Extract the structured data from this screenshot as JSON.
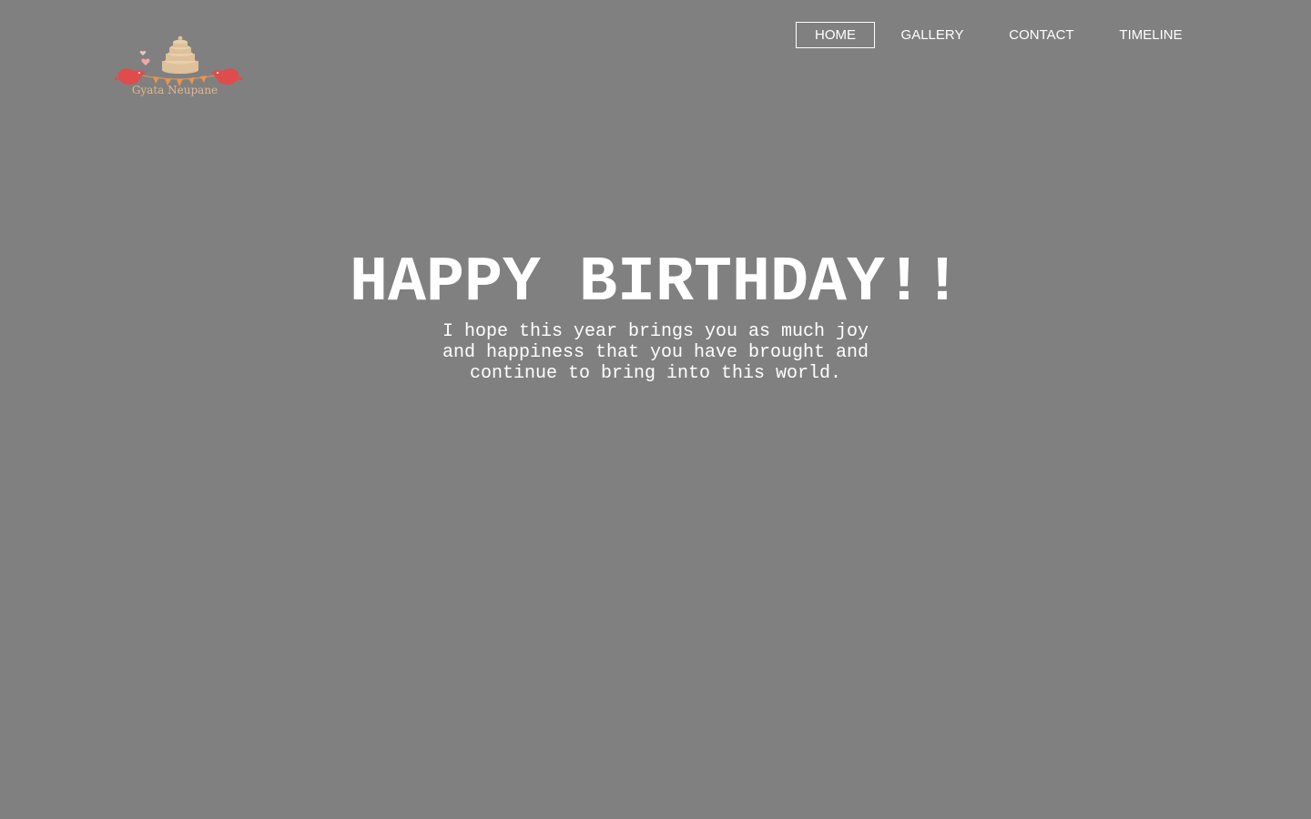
{
  "logo": {
    "text": "Gyata Neupane",
    "icon": "birthday-cake-with-birds-and-bunting-icon",
    "colors": {
      "cake": "#dec09a",
      "birds": "#e04b4b",
      "bunting": "#e9954f",
      "text": "#e3b889"
    }
  },
  "nav": {
    "items": [
      {
        "label": "HOME",
        "active": true
      },
      {
        "label": "GALLERY",
        "active": false
      },
      {
        "label": "CONTACT",
        "active": false
      },
      {
        "label": "TIMELINE",
        "active": false
      }
    ]
  },
  "hero": {
    "title": "HAPPY BIRTHDAY!!",
    "message_lines": [
      "I hope this year brings you as much joy",
      "and happiness that you have brought and",
      "continue to bring into this world."
    ]
  },
  "colors": {
    "background": "#808080",
    "text": "#ffffff"
  }
}
